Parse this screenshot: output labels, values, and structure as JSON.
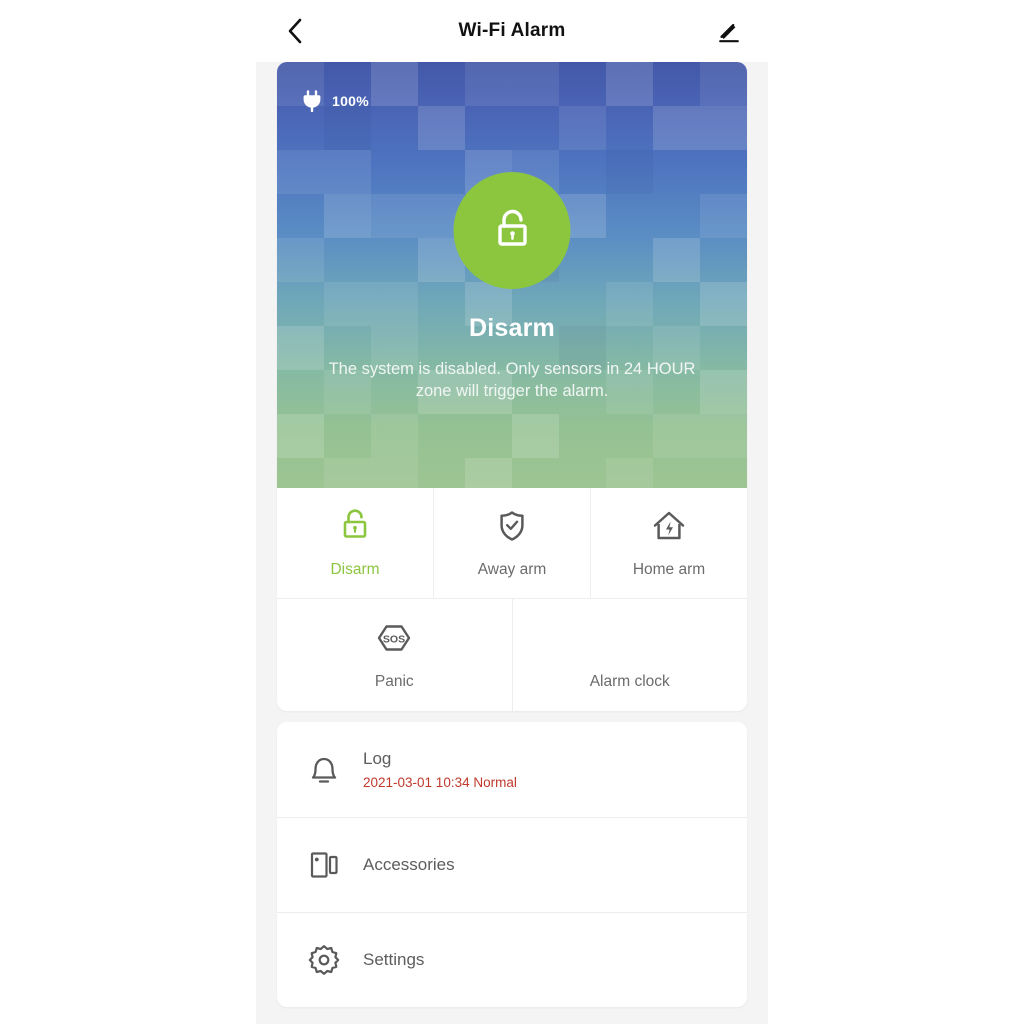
{
  "header": {
    "title": "Wi-Fi Alarm",
    "back_icon": "chevron-left-icon",
    "edit_icon": "pencil-icon"
  },
  "hero": {
    "battery_icon": "power-plug-icon",
    "battery_label": "100%",
    "status_icon": "unlock-icon",
    "status_title": "Disarm",
    "status_description": "The system is disabled. Only sensors in 24 HOUR zone will trigger the alarm.",
    "accent_color": "#8cc63f"
  },
  "modes": [
    {
      "label": "Disarm",
      "icon": "unlock-icon",
      "active": true
    },
    {
      "label": "Away arm",
      "icon": "shield-check-icon",
      "active": false
    },
    {
      "label": "Home arm",
      "icon": "house-bolt-icon",
      "active": false
    }
  ],
  "modes_secondary": [
    {
      "label": "Panic",
      "icon": "sos-hexagon-icon"
    },
    {
      "label": "Alarm clock",
      "icon": ""
    }
  ],
  "list": [
    {
      "label": "Log",
      "icon": "bell-icon",
      "sub": "2021-03-01 10:34 Normal",
      "sub_color": "#c0392b"
    },
    {
      "label": "Accessories",
      "icon": "door-sensor-icon",
      "sub": ""
    },
    {
      "label": "Settings",
      "icon": "gear-icon",
      "sub": ""
    }
  ]
}
